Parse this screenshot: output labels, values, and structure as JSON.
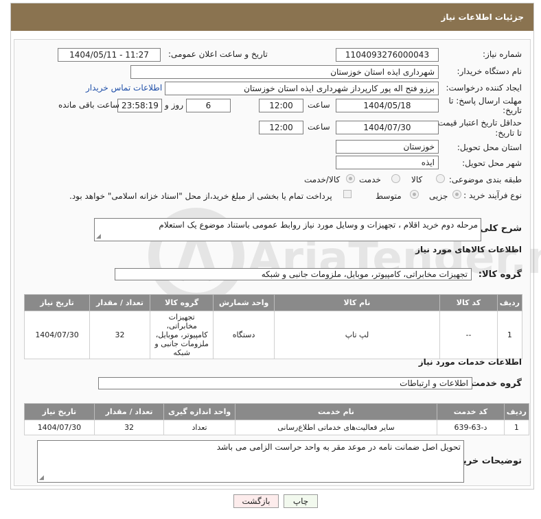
{
  "page": {
    "title": "جزئیات اطلاعات نیاز"
  },
  "form": {
    "need_number": {
      "label": "شماره نیاز:",
      "value": "1104093276000043"
    },
    "announce_datetime": {
      "label": "تاریخ و ساعت اعلان عمومی:",
      "value": "1404/05/11 - 11:27"
    },
    "buyer_org": {
      "label": "نام دستگاه خریدار:",
      "value": "شهرداری ایذه استان خوزستان"
    },
    "requester": {
      "label": "ایجاد کننده درخواست:",
      "value": "برزو فتح اله پور کارپرداز شهرداری ایذه استان خوزستان",
      "contact_link": "اطلاعات تماس خریدار"
    },
    "response_deadline": {
      "label_line1": "مهلت ارسال پاسخ: تا",
      "label_line2": "تاریخ:",
      "date": "1404/05/18",
      "time_label": "ساعت",
      "time": "12:00",
      "days": "6",
      "days_label": "روز و",
      "remaining": "23:58:19",
      "remaining_label": "ساعت باقی مانده"
    },
    "price_validity": {
      "label_line1": "حداقل تاریخ اعتبار قیمت:",
      "label_line2": "تا تاریخ:",
      "date": "1404/07/30",
      "time_label": "ساعت",
      "time": "12:00"
    },
    "delivery_province": {
      "label": "استان محل تحویل:",
      "value": "خوزستان"
    },
    "delivery_city": {
      "label": "شهر محل تحویل:",
      "value": "ایذه"
    },
    "category": {
      "label": "طبقه بندی موضوعی:",
      "options": [
        "کالا",
        "خدمت",
        "کالا/خدمت"
      ],
      "selected": "کالا/خدمت"
    },
    "process_type": {
      "label": "نوع فرآیند خرید :",
      "options": [
        "جزیی",
        "متوسط"
      ],
      "selected": "جزیی",
      "payment_note": "پرداخت تمام یا بخشی از مبلغ خرید،از محل \"اسناد خزانه اسلامی\" خواهد بود."
    },
    "general_description": {
      "label": "شرح کلی نیاز:",
      "value": "مرحله دوم خرید اقلام ، تجهیزات و وسایل مورد نیاز روابط عمومی باستناد موضوع یک استعلام"
    }
  },
  "goods": {
    "section_title": "اطلاعات کالاهای مورد نیاز",
    "group_label": "گروه کالا:",
    "group_value": "تجهیزات مخابراتی، کامپیوتر، موبایل، ملزومات جانبی و شبکه",
    "columns": [
      "ردیف",
      "کد کالا",
      "نام کالا",
      "واحد شمارش",
      "گروه کالا",
      "تعداد / مقدار",
      "تاریخ نیاز"
    ],
    "rows": [
      {
        "row": "1",
        "code": "--",
        "name": "لپ تاپ",
        "unit": "دستگاه",
        "group": "تجهیزات مخابراتی، کامپیوتر، موبایل، ملزومات جانبی و شبکه",
        "qty": "32",
        "date": "1404/07/30"
      }
    ]
  },
  "services": {
    "section_title": "اطلاعات خدمات مورد نیاز",
    "group_label": "گروه خدمت:",
    "group_value": "اطلاعات و ارتباطات",
    "columns": [
      "ردیف",
      "کد خدمت",
      "نام خدمت",
      "واحد اندازه گیری",
      "تعداد / مقدار",
      "تاریخ نیاز"
    ],
    "rows": [
      {
        "row": "1",
        "code": "د-63-639",
        "name": "سایر فعالیت‌های خدماتی اطلاع‌رسانی",
        "unit": "تعداد",
        "qty": "32",
        "date": "1404/07/30"
      }
    ]
  },
  "buyer_notes": {
    "label": "توضیحات خریدار:",
    "value": "تحویل اصل ضمانت نامه در موعد مقر به واحد حراست الزامی می باشد"
  },
  "buttons": {
    "print": "چاپ",
    "back": "بازگشت"
  },
  "watermark": {
    "brand": "AriaTender.net"
  }
}
